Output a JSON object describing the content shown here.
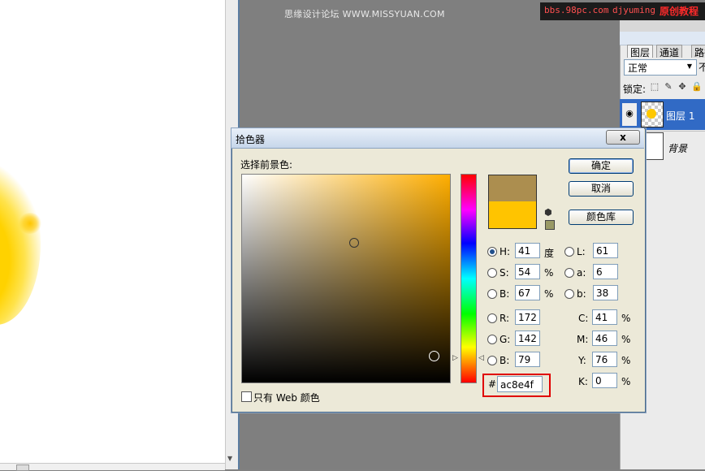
{
  "watermarks": {
    "left": "思缘设计论坛 WWW.MISSYUAN.COM",
    "bbs": "bbs.98pc.com",
    "user": "djyuming",
    "original": "原创教程"
  },
  "layers_panel": {
    "tabs": [
      "图层",
      "通道",
      "路径"
    ],
    "blend_mode": "正常",
    "opacity_label_cut": "不",
    "lock_label": "锁定:",
    "layers": [
      {
        "name": "图层 1",
        "selected": true,
        "visible": true
      },
      {
        "name": "背景",
        "selected": false,
        "visible": false
      }
    ]
  },
  "color_picker": {
    "title": "拾色器",
    "close_label": "x",
    "foreground_label": "选择前景色:",
    "buttons": {
      "ok": "确定",
      "cancel": "取消",
      "library": "颜色库"
    },
    "new_color": "#ac8e4f",
    "current_color": "#ffc400",
    "websafe_color": "#999966",
    "hsb": {
      "h": {
        "label": "H:",
        "value": "41",
        "unit": "度"
      },
      "s": {
        "label": "S:",
        "value": "54",
        "unit": "%"
      },
      "b": {
        "label": "B:",
        "value": "67",
        "unit": "%"
      }
    },
    "lab": {
      "l": {
        "label": "L:",
        "value": "61"
      },
      "a": {
        "label": "a:",
        "value": "6"
      },
      "b": {
        "label": "b:",
        "value": "38"
      }
    },
    "rgb": {
      "r": {
        "label": "R:",
        "value": "172"
      },
      "g": {
        "label": "G:",
        "value": "142"
      },
      "b": {
        "label": "B:",
        "value": "79"
      }
    },
    "cmyk": {
      "c": {
        "label": "C:",
        "value": "41",
        "unit": "%"
      },
      "m": {
        "label": "M:",
        "value": "46",
        "unit": "%"
      },
      "y": {
        "label": "Y:",
        "value": "76",
        "unit": "%"
      },
      "k": {
        "label": "K:",
        "value": "0",
        "unit": "%"
      }
    },
    "hex": {
      "label": "#",
      "value": "ac8e4f"
    },
    "web_only_label": "只有 Web 颜色",
    "web_only_checked": false
  },
  "colors": {
    "workspace": "#7f7f7f",
    "selection": "#316ac5",
    "highlight": "#e00000"
  }
}
